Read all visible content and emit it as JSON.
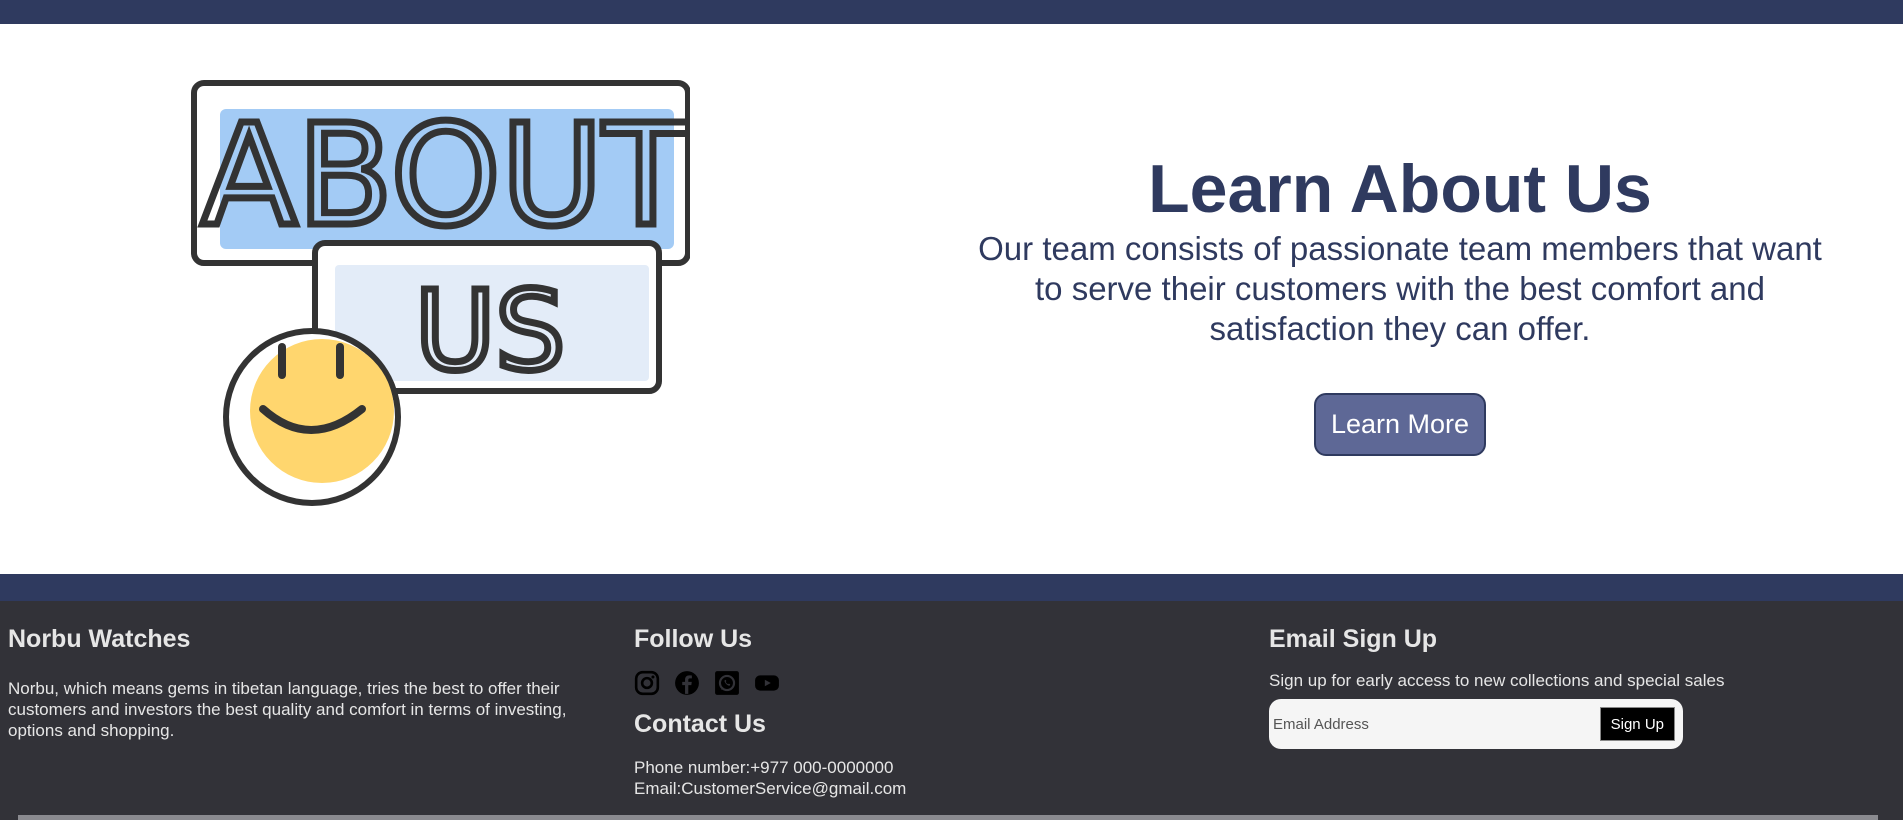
{
  "hero": {
    "image_text_top": "ABOUT",
    "image_text_bottom": "US",
    "title": "Learn About Us",
    "description": "Our team consists of passionate team members that want to serve their customers with the best comfort and satisfaction they can offer.",
    "button_label": "Learn More"
  },
  "footer": {
    "brand": {
      "title": "Norbu Watches",
      "description": "Norbu, which means gems in tibetan language, tries the best to offer their customers and investors the best quality and comfort in terms of investing, options and shopping."
    },
    "follow": {
      "title": "Follow Us",
      "icons": [
        "instagram-icon",
        "facebook-icon",
        "whatsapp-icon",
        "youtube-icon"
      ]
    },
    "contact": {
      "title": "Contact Us",
      "phone": "Phone number:+977 000-0000000",
      "email": "Email:CustomerService@gmail.com"
    },
    "signup": {
      "title": "Email Sign Up",
      "description": "Sign up for early access to new collections and special sales",
      "placeholder": "Email Address",
      "button_label": "Sign Up"
    }
  },
  "colors": {
    "navy": "#2f3a5f",
    "button": "#5e6896",
    "footer_bg": "#323238",
    "about_blue": "#a3cbf5",
    "us_blue": "#e3ecf8",
    "smiley_yellow": "#ffd66e"
  }
}
